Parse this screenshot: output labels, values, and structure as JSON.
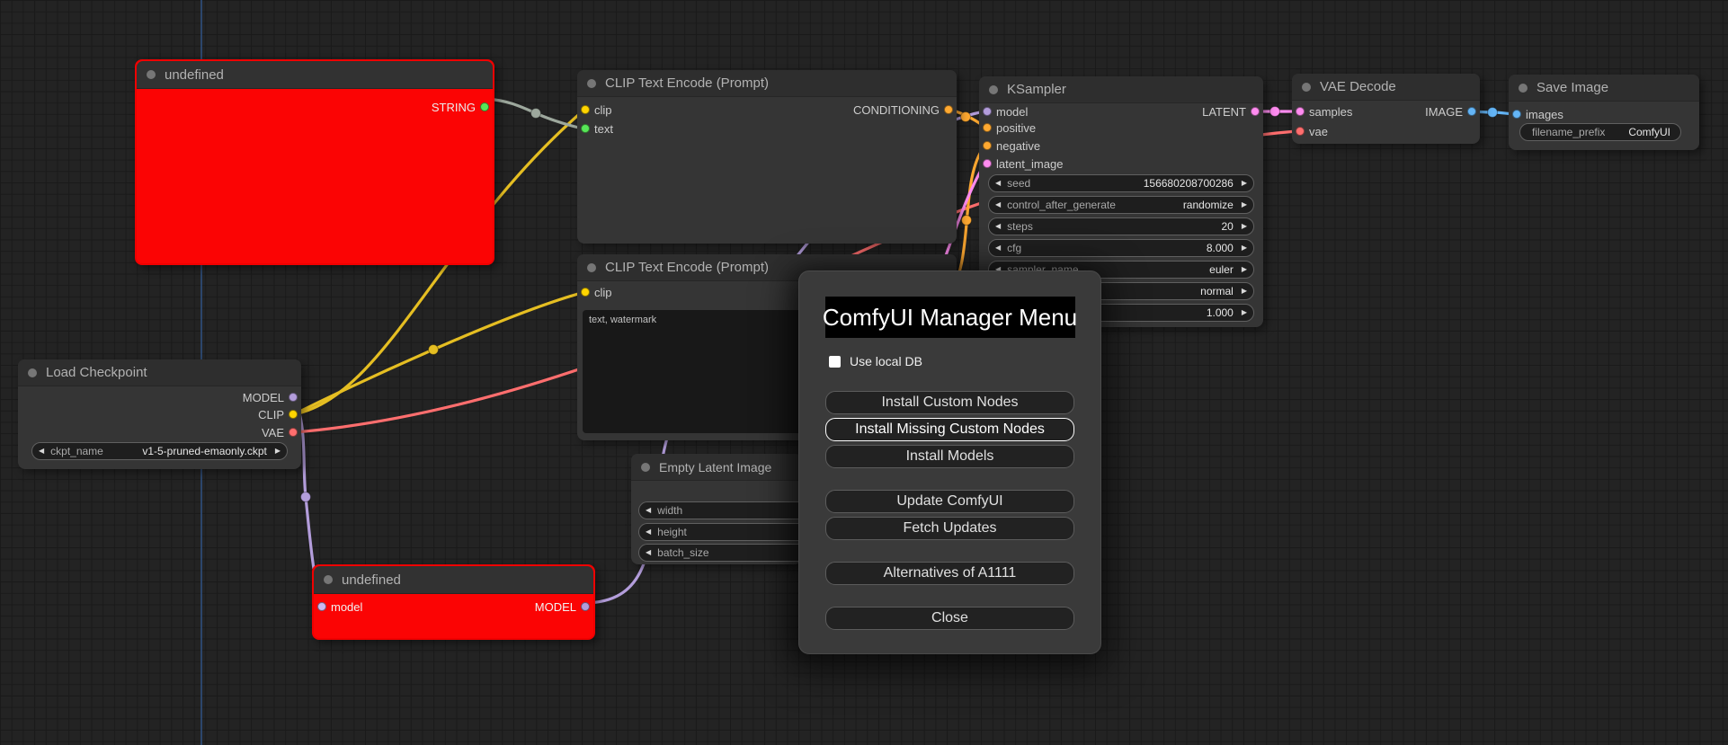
{
  "palette": {
    "error_node_red": "#fb0404",
    "wire_clip_yellow": "#e5be22",
    "wire_model_purple": "#b39ddb",
    "wire_vae_red": "#ff6e6e",
    "wire_string_sage": "#9da89d",
    "wire_conditioning_orange": "#ffa931",
    "wire_latent_pink": "#ff8cf0",
    "wire_image_blue": "#64b5f6",
    "slot_string_green": "#57e657",
    "slot_clip_yellow": "#ffd500"
  },
  "nodes": {
    "undefined_top": {
      "title": "undefined",
      "output": "STRING"
    },
    "clip1": {
      "title": "CLIP Text Encode (Prompt)",
      "inputs": [
        "clip",
        "text"
      ],
      "output": "CONDITIONING"
    },
    "clip2": {
      "title": "CLIP Text Encode (Prompt)",
      "inputs": [
        "clip"
      ],
      "text": "text, watermark"
    },
    "ksampler": {
      "title": "KSampler",
      "inputs": [
        "model",
        "positive",
        "negative",
        "latent_image"
      ],
      "output": "LATENT",
      "widgets": [
        {
          "label": "seed",
          "value": "156680208700286"
        },
        {
          "label": "control_after_generate",
          "value": "randomize"
        },
        {
          "label": "steps",
          "value": "20"
        },
        {
          "label": "cfg",
          "value": "8.000"
        },
        {
          "label": "sampler_name",
          "value": "euler"
        },
        {
          "label": "",
          "value": "normal"
        },
        {
          "label": "",
          "value": "1.000"
        }
      ]
    },
    "vae_decode": {
      "title": "VAE Decode",
      "inputs": [
        "samples",
        "vae"
      ],
      "output": "IMAGE"
    },
    "save_image": {
      "title": "Save Image",
      "inputs": [
        "images"
      ],
      "widget": {
        "label": "filename_prefix",
        "value": "ComfyUI"
      }
    },
    "load_checkpoint": {
      "title": "Load Checkpoint",
      "outputs": [
        "MODEL",
        "CLIP",
        "VAE"
      ],
      "widget": {
        "label": "ckpt_name",
        "value": "v1-5-pruned-emaonly.ckpt"
      }
    },
    "empty_latent": {
      "title": "Empty Latent Image",
      "widgets": [
        {
          "label": "width"
        },
        {
          "label": "height"
        },
        {
          "label": "batch_size"
        }
      ]
    },
    "undefined_bottom": {
      "title": "undefined",
      "input": "model",
      "output": "MODEL"
    }
  },
  "dialog": {
    "title": "ComfyUI Manager Menu",
    "checkbox_label": "Use local DB",
    "buttons": [
      {
        "label": "Install Custom Nodes"
      },
      {
        "label": "Install Missing Custom Nodes"
      },
      {
        "label": "Install Models"
      },
      {
        "label": "Update ComfyUI"
      },
      {
        "label": "Fetch Updates"
      },
      {
        "label": "Alternatives of A1111"
      },
      {
        "label": "Close"
      }
    ]
  }
}
